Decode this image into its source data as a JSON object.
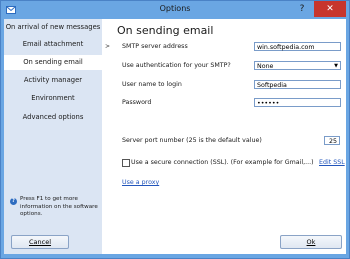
{
  "window": {
    "title": "Options",
    "help": "?",
    "close": "✕"
  },
  "sidebar": {
    "items": [
      {
        "label": "On arrival of new messages"
      },
      {
        "label": "Email attachment"
      },
      {
        "label": "On sending email"
      },
      {
        "label": "Activity manager"
      },
      {
        "label": "Environment"
      },
      {
        "label": "Advanced options"
      }
    ],
    "active_index": 2,
    "help_text": "Press F1 to get more information on the software options.",
    "cancel_label": "Cancel"
  },
  "main": {
    "heading": "On sending email",
    "smtp_label": "SMTP server address",
    "smtp_value": "win.softpedia.com",
    "auth_label": "Use authentication for your SMTP?",
    "auth_value": "None",
    "user_label": "User name to login",
    "user_value": "Softpedia",
    "password_label": "Password",
    "password_value": "••••••",
    "port_label": "Server port number (25 is the default value)",
    "port_value": "25",
    "ssl_label": "Use a secure connection (SSL). (For example for Gmail,...)",
    "edit_ssl": "Edit SSL",
    "proxy_link": "Use a proxy",
    "ok_label": "Ok"
  },
  "colors": {
    "title_bar": "#6aa6e3",
    "sidebar_bg": "#dbe5f3",
    "close_red": "#c7352d",
    "link": "#2255bb"
  }
}
